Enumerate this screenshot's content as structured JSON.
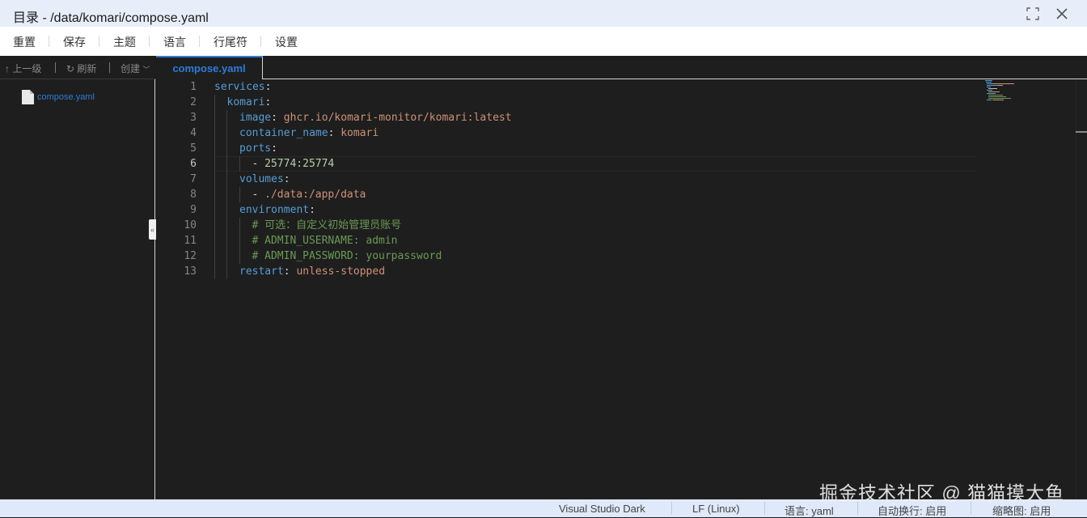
{
  "window": {
    "title": "目录 - /data/komari/compose.yaml",
    "maximize_icon": "maximize-icon",
    "close_icon": "close-icon"
  },
  "menu": {
    "items": [
      "重置",
      "保存",
      "主题",
      "语言",
      "行尾符",
      "设置"
    ]
  },
  "sidebar": {
    "toolbar": {
      "up": "上一级",
      "refresh": "刷新",
      "create": "创建"
    },
    "files": [
      {
        "name": "compose.yaml",
        "icon": "file-icon"
      }
    ],
    "collapse_label": "«"
  },
  "editor": {
    "tabs": [
      {
        "label": "compose.yaml",
        "active": true
      }
    ],
    "active_line": 6,
    "line_numbers": [
      "1",
      "2",
      "3",
      "4",
      "5",
      "6",
      "7",
      "8",
      "9",
      "10",
      "11",
      "12",
      "13"
    ],
    "lines": [
      {
        "k": "services",
        "p": ":"
      },
      {
        "k": "komari",
        "p": ":"
      },
      {
        "k": "image",
        "p": ": ",
        "v": "ghcr.io/komari-monitor/komari:latest"
      },
      {
        "k": "container_name",
        "p": ": ",
        "v": "komari"
      },
      {
        "k": "ports",
        "p": ":"
      },
      {
        "d": "- ",
        "n": "25774:25774"
      },
      {
        "k": "volumes",
        "p": ":"
      },
      {
        "d": "- ",
        "v": "./data:/app/data"
      },
      {
        "k": "environment",
        "p": ":"
      },
      {
        "c": "# 可选：自定义初始管理员账号"
      },
      {
        "c": "# ADMIN_USERNAME: admin"
      },
      {
        "c": "# ADMIN_PASSWORD: yourpassword"
      },
      {
        "k": "restart",
        "p": ": ",
        "v": "unless-stopped"
      }
    ],
    "colors": {
      "key": "#569cd6",
      "string": "#ce9178",
      "number": "#b5cea8",
      "comment": "#6a9955",
      "background": "#1e1e1e"
    }
  },
  "status": {
    "theme": "Visual Studio Dark",
    "eol": "LF (Linux)",
    "language": "语言: yaml",
    "wrap": "自动换行: 启用",
    "minimap": "缩略图: 启用"
  },
  "watermark": "掘金技术社区 @ 猫猫摸大鱼"
}
